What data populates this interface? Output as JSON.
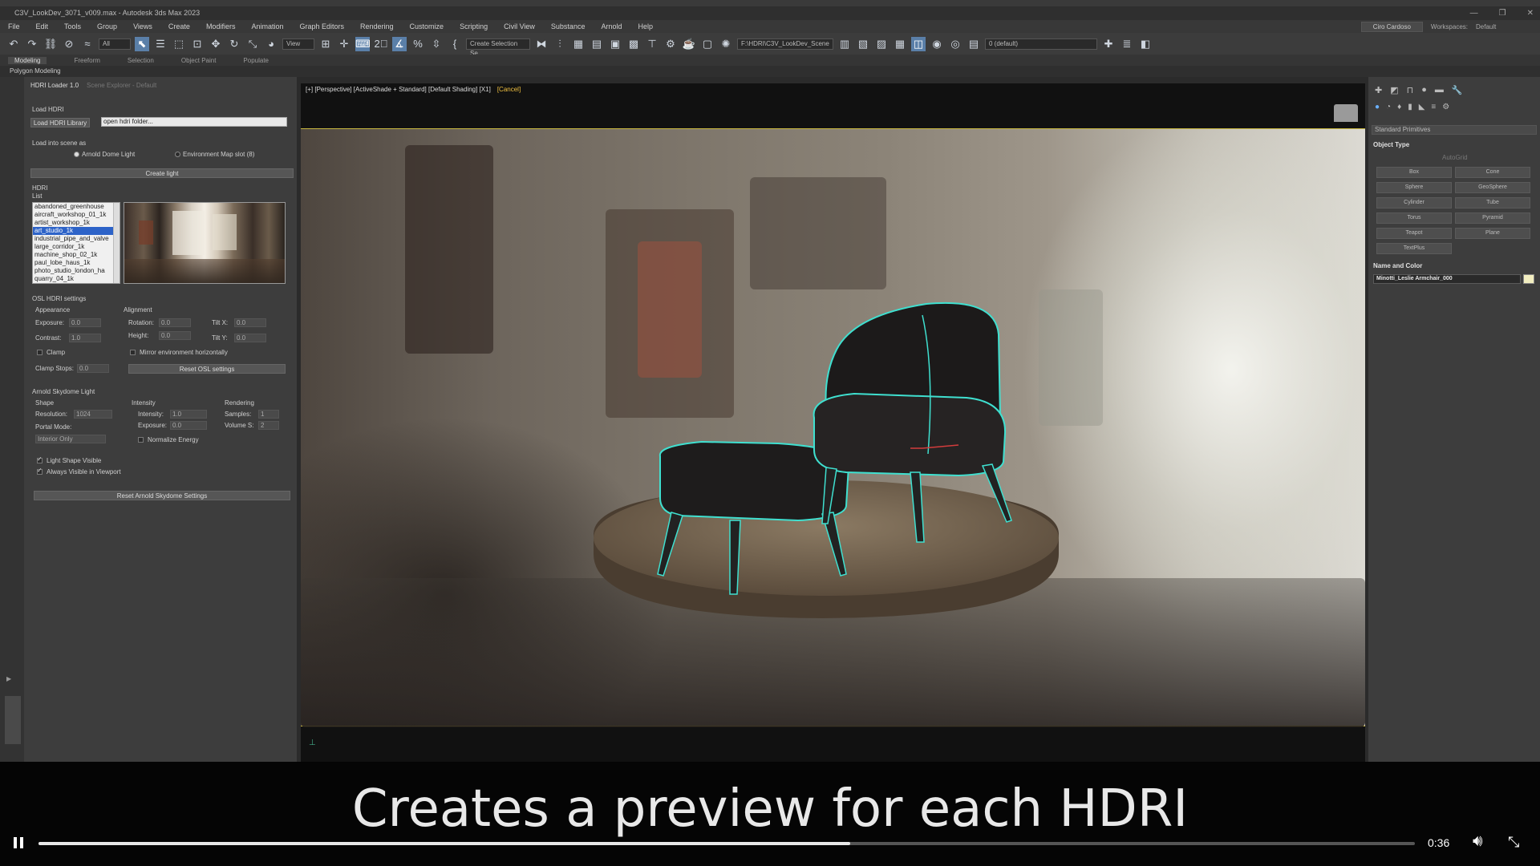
{
  "window": {
    "title": "C3V_LookDev_3071_v009.max - Autodesk 3ds Max 2023",
    "controls": [
      "—",
      "❐",
      "✕"
    ]
  },
  "menu": {
    "items": [
      "File",
      "Edit",
      "Tools",
      "Group",
      "Views",
      "Create",
      "Modifiers",
      "Animation",
      "Graph Editors",
      "Rendering",
      "Customize",
      "Scripting",
      "Civil View",
      "Substance",
      "Arnold",
      "Help"
    ],
    "user": "Ciro Cardoso",
    "workspace_label": "Workspaces:",
    "workspace_value": "Default"
  },
  "toolbar": {
    "filter": "All",
    "view": "View",
    "selection_set": "Create Selection Se",
    "layer_path": "F:\\HDRI\\C3V_LookDev_Scene",
    "layer_default": "0 (default)"
  },
  "ribbon": {
    "tabs": [
      "Modeling",
      "Freeform",
      "Selection",
      "Object Paint",
      "Populate"
    ],
    "sub": "Polygon Modeling"
  },
  "left_panel": {
    "tabs": [
      "HDRI Loader 1.0",
      "Scene Explorer - Default"
    ],
    "load_hdri_title": "Load HDRI",
    "load_library_button": "Load HDRI Library",
    "folder_field": "open hdri folder...",
    "load_into_label": "Load into scene as",
    "radio_dome": "Arnold Dome Light",
    "radio_envmap": "Environment Map slot (8)",
    "create_light_button": "Create light",
    "hdri_label": "HDRI",
    "list_label": "List",
    "hdri_list": [
      "abandoned_greenhouse",
      "aircraft_workshop_01_1k",
      "artist_workshop_1k",
      "art_studio_1k",
      "industrial_pipe_and_valve",
      "large_corridor_1k",
      "machine_shop_02_1k",
      "paul_lobe_haus_1k",
      "photo_studio_london_ha",
      "quarry_04_1k"
    ],
    "hdri_selected_index": 3,
    "osl_title": "OSL HDRI settings",
    "appearance": "Appearance",
    "alignment": "Alignment",
    "exposure_label": "Exposure:",
    "exposure_value": "0.0",
    "contrast_label": "Contrast:",
    "contrast_value": "1.0",
    "rotation_label": "Rotation:",
    "rotation_value": "0.0",
    "height_label": "Height:",
    "height_value": "0.0",
    "tiltx_label": "Tilt X:",
    "tiltx_value": "0.0",
    "tilty_label": "Tilt Y:",
    "tilty_value": "0.0",
    "clamp_label": "Clamp",
    "mirror_label": "Mirror environment horizontally",
    "clamp_stops_label": "Clamp Stops:",
    "clamp_stops_value": "0.0",
    "reset_osl_button": "Reset OSL settings",
    "skydome_title": "Arnold Skydome Light",
    "shape": "Shape",
    "intensity": "Intensity",
    "rendering": "Rendering",
    "resolution_label": "Resolution:",
    "resolution_value": "1024",
    "intensity_label": "Intensity:",
    "intensity_value": "1.0",
    "samples_label": "Samples:",
    "samples_value": "1",
    "exposure2_label": "Exposure:",
    "exposure2_value": "0.0",
    "volume_label": "Volume S:",
    "volume_value": "2",
    "portal_label": "Portal Mode:",
    "portal_value": "Interior Only",
    "normalize_label": "Normalize Energy",
    "light_shape_label": "Light Shape Visible",
    "always_visible_label": "Always Visible in Viewport",
    "reset_skydome_button": "Reset Arnold Skydome Settings"
  },
  "viewport": {
    "label": "[+] [Perspective] [ActiveShade + Standard] [Default Shading] [X1]",
    "cancel": "[Cancel]"
  },
  "right_panel": {
    "dropdown": "Standard Primitives",
    "object_type": "Object Type",
    "autogrid": "AutoGrid",
    "primitives": [
      "Box",
      "Cone",
      "Sphere",
      "GeoSphere",
      "Cylinder",
      "Tube",
      "Torus",
      "Pyramid",
      "Teapot",
      "Plane",
      "TextPlus"
    ],
    "name_color": "Name and Color",
    "object_name": "Minotti_Leslie Armchair_000",
    "swatch_color": "#f2eec0"
  },
  "video": {
    "caption": "Creates a preview for each HDRI",
    "timecode": "0:36",
    "progress_percent": 59
  },
  "colors": {
    "selection_outline": "#3fe0d0",
    "viewport_border": "#c9b840"
  }
}
